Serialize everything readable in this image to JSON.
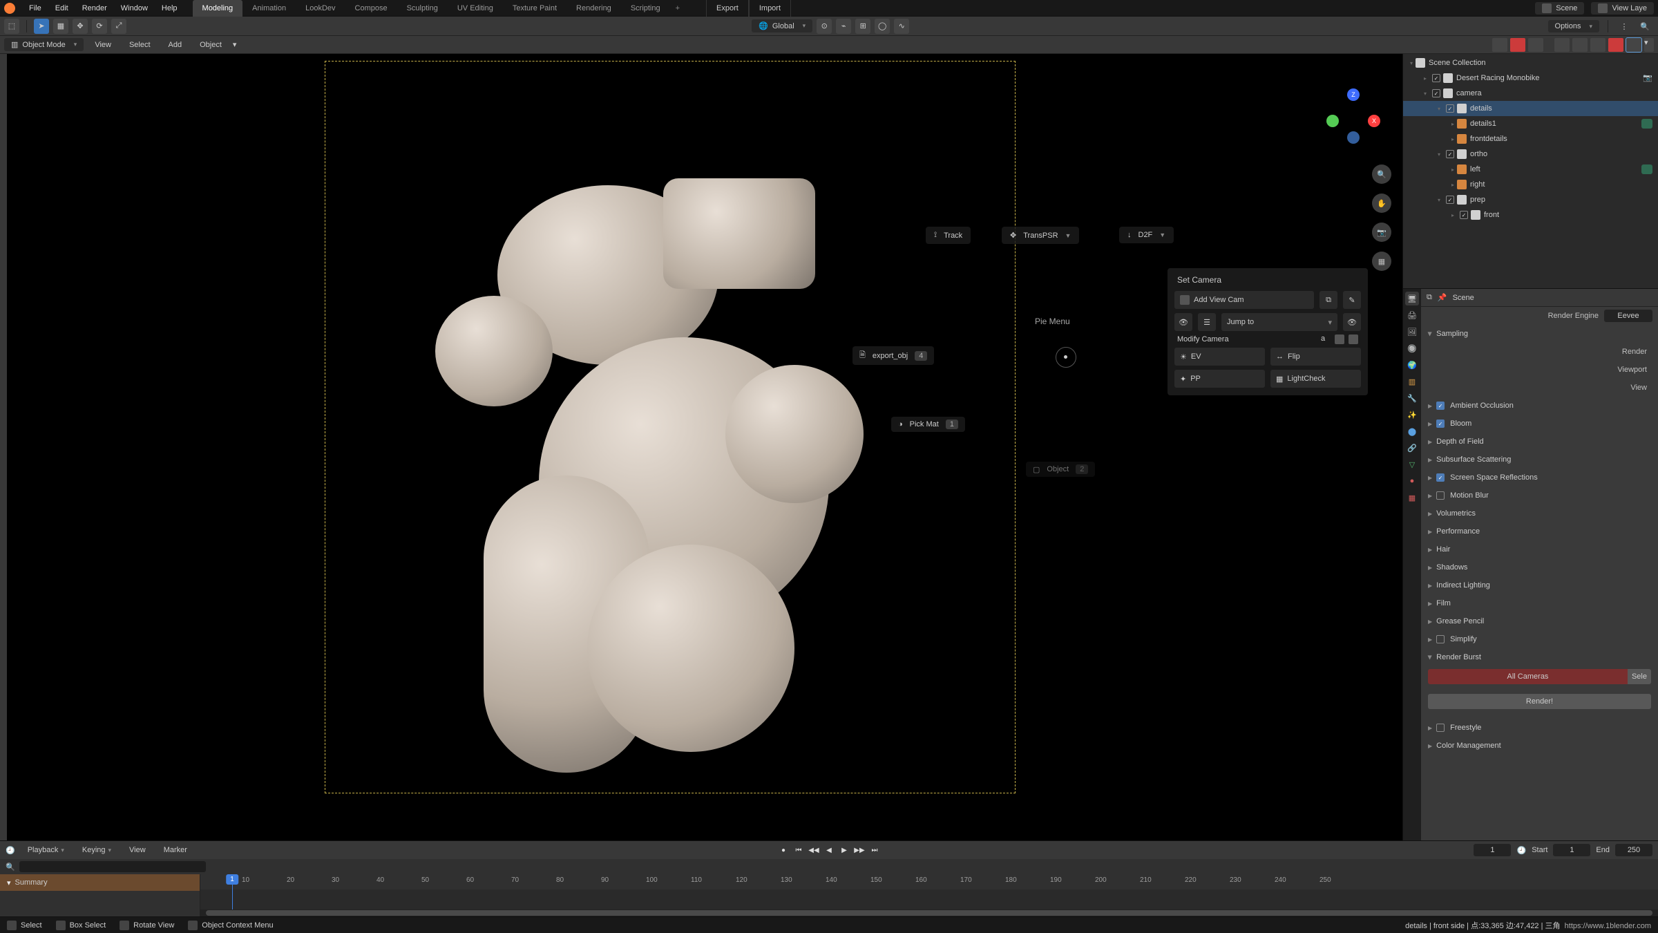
{
  "menu": {
    "items": [
      "File",
      "Edit",
      "Render",
      "Window",
      "Help"
    ]
  },
  "workspaces": {
    "items": [
      "Modeling",
      "Animation",
      "LookDev",
      "Compose",
      "Sculpting",
      "UV Editing",
      "Texture Paint",
      "Rendering",
      "Scripting"
    ],
    "active_index": 0,
    "export": "Export",
    "import": "Import"
  },
  "top_right": {
    "scene": "Scene",
    "viewlayer": "View Laye"
  },
  "toolbar": {
    "orientation": "Global",
    "options": "Options"
  },
  "header3d": {
    "mode": "Object Mode",
    "menus": [
      "View",
      "Select",
      "Add",
      "Object"
    ]
  },
  "gizmo": {
    "x": "X",
    "y": "",
    "z": "Z"
  },
  "floaters": {
    "track": "Track",
    "transpsr": "TransPSR",
    "d2f": "D2F",
    "export_obj": {
      "label": "export_obj",
      "count": "4"
    },
    "pick_mat": {
      "label": "Pick Mat",
      "count": "1"
    },
    "object": {
      "label": "Object",
      "count": "2"
    },
    "pie": "Pie Menu"
  },
  "cam_panel": {
    "title": "Set Camera",
    "add_view_cam": "Add View Cam",
    "jump_to": "Jump to",
    "modify": "Modify Camera",
    "ev": "EV",
    "flip": "Flip",
    "pp": "PP",
    "lightcheck": "LightCheck"
  },
  "outliner": {
    "root": "Scene Collection",
    "items": [
      {
        "depth": 1,
        "type": "coll",
        "label": "Desert Racing Monobike",
        "twist": "▸",
        "check": true,
        "end": "cam"
      },
      {
        "depth": 1,
        "type": "coll",
        "label": "camera",
        "twist": "▾",
        "check": true,
        "end": ""
      },
      {
        "depth": 2,
        "type": "coll",
        "label": "details",
        "twist": "▾",
        "check": true,
        "sel": true
      },
      {
        "depth": 3,
        "type": "mesh",
        "label": "details1",
        "twist": "▸",
        "badge": true
      },
      {
        "depth": 3,
        "type": "mesh",
        "label": "frontdetails",
        "twist": "▸"
      },
      {
        "depth": 2,
        "type": "coll",
        "label": "ortho",
        "twist": "▾",
        "check": true
      },
      {
        "depth": 3,
        "type": "mesh",
        "label": "left",
        "twist": "▸",
        "badge": true
      },
      {
        "depth": 3,
        "type": "mesh",
        "label": "right",
        "twist": "▸"
      },
      {
        "depth": 2,
        "type": "coll",
        "label": "prep",
        "twist": "▾",
        "check": true
      },
      {
        "depth": 3,
        "type": "coll",
        "label": "front",
        "twist": "▸",
        "check": true
      }
    ]
  },
  "props": {
    "scene": "Scene",
    "engine_label": "Render Engine",
    "engine_value": "Eevee",
    "sampling": "Sampling",
    "render_label": "Render",
    "viewport_label": "Viewport",
    "viewport_den": "View",
    "sections": [
      {
        "label": "Ambient Occlusion",
        "chk": true
      },
      {
        "label": "Bloom",
        "chk": true
      },
      {
        "label": "Depth of Field"
      },
      {
        "label": "Subsurface Scattering"
      },
      {
        "label": "Screen Space Reflections",
        "chk": true
      },
      {
        "label": "Motion Blur",
        "chk": false
      },
      {
        "label": "Volumetrics"
      },
      {
        "label": "Performance"
      },
      {
        "label": "Hair"
      },
      {
        "label": "Shadows"
      },
      {
        "label": "Indirect Lighting"
      },
      {
        "label": "Film"
      },
      {
        "label": "Grease Pencil"
      },
      {
        "label": "Simplify",
        "chk": false
      }
    ],
    "render_burst": "Render Burst",
    "all_cameras": "All Cameras",
    "sel": "Sele",
    "render_btn": "Render!",
    "freestyle": {
      "label": "Freestyle",
      "chk": false
    },
    "colmgmt": "Color Management"
  },
  "timeline": {
    "playback": "Playback",
    "keying": "Keying",
    "view": "View",
    "marker": "Marker",
    "current": "1",
    "start_label": "Start",
    "start": "1",
    "end_label": "End",
    "end": "250",
    "summary": "Summary",
    "cursor": "1",
    "ticks": [
      "10",
      "20",
      "30",
      "40",
      "50",
      "60",
      "70",
      "80",
      "90",
      "100",
      "110",
      "120",
      "130",
      "140",
      "150",
      "160",
      "170",
      "180",
      "190",
      "200",
      "210",
      "220",
      "230",
      "240",
      "250"
    ]
  },
  "status": {
    "select": "Select",
    "box": "Box Select",
    "rotate": "Rotate View",
    "ctx": "Object Context Menu",
    "info": "details | front side | 点:33,365  边:47,422 | 三角",
    "url": "https://www.1blender.com"
  }
}
